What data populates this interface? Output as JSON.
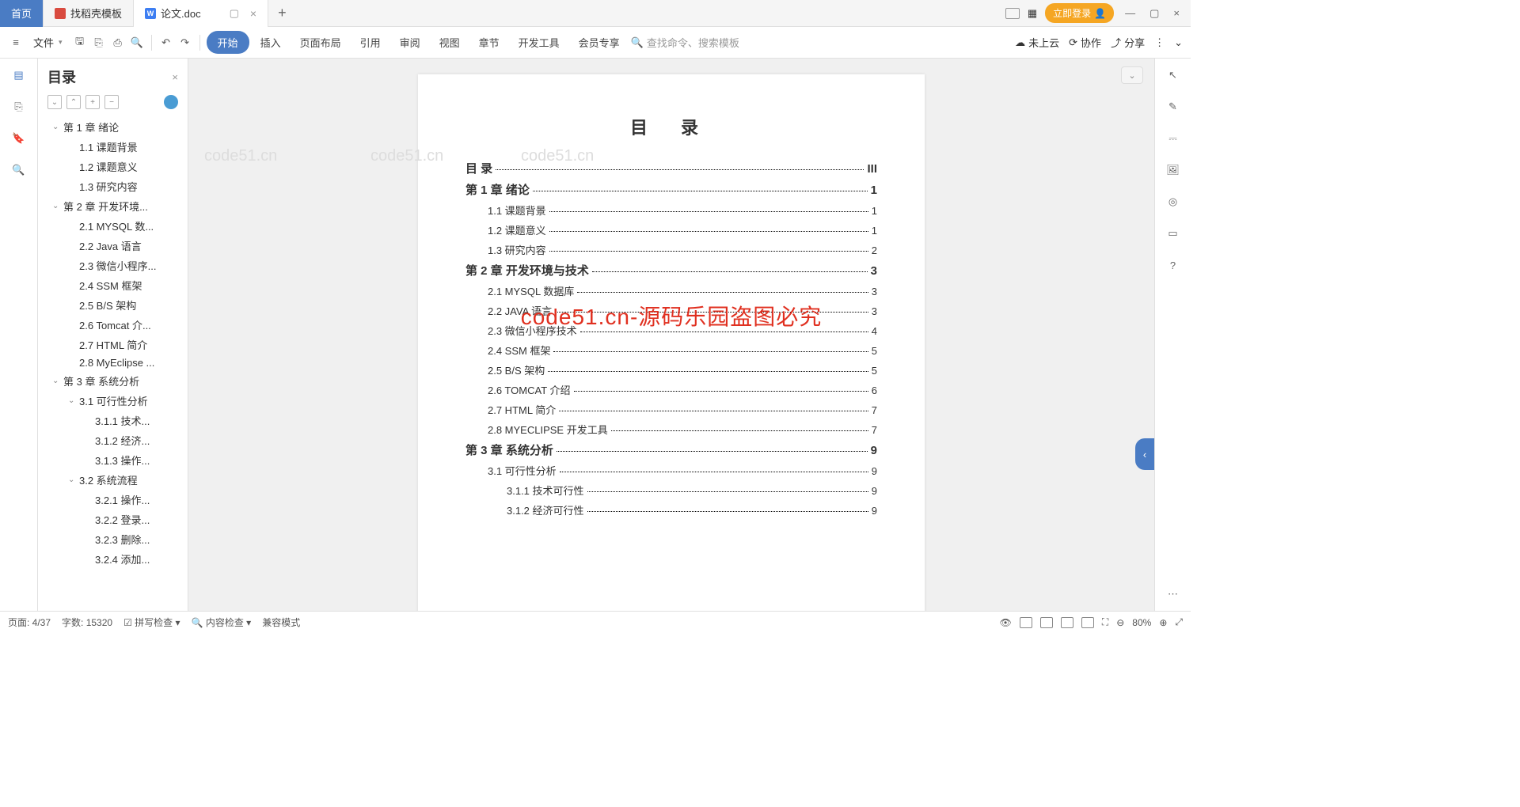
{
  "tabs": {
    "home": "首页",
    "template": "找稻壳模板",
    "document": "论文.doc"
  },
  "login_button": "立即登录",
  "file_label": "文件",
  "menu": {
    "start": "开始",
    "insert": "插入",
    "layout": "页面布局",
    "reference": "引用",
    "review": "审阅",
    "view": "视图",
    "chapter": "章节",
    "devtools": "开发工具",
    "member": "会员专享"
  },
  "search_placeholder": "查找命令、搜索模板",
  "cloud_status": "未上云",
  "collab": "协作",
  "share": "分享",
  "outline": {
    "title": "目录",
    "items": [
      {
        "level": 1,
        "text": "第 1 章 绪论",
        "chev": true
      },
      {
        "level": 2,
        "text": "1.1 课题背景"
      },
      {
        "level": 2,
        "text": "1.2 课题意义"
      },
      {
        "level": 2,
        "text": "1.3 研究内容"
      },
      {
        "level": 1,
        "text": "第 2 章 开发环境...",
        "chev": true
      },
      {
        "level": 2,
        "text": "2.1 MYSQL 数..."
      },
      {
        "level": 2,
        "text": "2.2 Java 语言"
      },
      {
        "level": 2,
        "text": "2.3 微信小程序..."
      },
      {
        "level": 2,
        "text": "2.4 SSM 框架"
      },
      {
        "level": 2,
        "text": "2.5 B/S 架构"
      },
      {
        "level": 2,
        "text": "2.6 Tomcat 介..."
      },
      {
        "level": 2,
        "text": "2.7 HTML 简介"
      },
      {
        "level": 2,
        "text": "2.8 MyEclipse ..."
      },
      {
        "level": 1,
        "text": "第 3 章 系统分析",
        "chev": true
      },
      {
        "level": 2,
        "text": "3.1 可行性分析",
        "chev": true
      },
      {
        "level": 3,
        "text": "3.1.1 技术..."
      },
      {
        "level": 3,
        "text": "3.1.2 经济..."
      },
      {
        "level": 3,
        "text": "3.1.3 操作..."
      },
      {
        "level": 2,
        "text": "3.2 系统流程",
        "chev": true
      },
      {
        "level": 3,
        "text": "3.2.1 操作..."
      },
      {
        "level": 3,
        "text": "3.2.2 登录..."
      },
      {
        "level": 3,
        "text": "3.2.3 删除..."
      },
      {
        "level": 3,
        "text": "3.2.4 添加..."
      }
    ]
  },
  "toc": {
    "heading": "目 录",
    "lines": [
      {
        "bold": true,
        "label": "目  录",
        "page": "III"
      },
      {
        "bold": true,
        "label": "第 1 章  绪论",
        "page": "1"
      },
      {
        "sub": true,
        "label": "1.1 课题背景",
        "page": "1"
      },
      {
        "sub": true,
        "label": "1.2 课题意义",
        "page": "1"
      },
      {
        "sub": true,
        "label": "1.3 研究内容",
        "page": "2"
      },
      {
        "bold": true,
        "label": "第 2 章  开发环境与技术",
        "page": "3"
      },
      {
        "sub": true,
        "label": "2.1 MYSQL 数据库",
        "page": "3"
      },
      {
        "sub": true,
        "label": "2.2 JAVA 语言",
        "page": "3"
      },
      {
        "sub": true,
        "label": "2.3 微信小程序技术",
        "page": "4"
      },
      {
        "sub": true,
        "label": "2.4 SSM 框架",
        "page": "5"
      },
      {
        "sub": true,
        "label": "2.5 B/S 架构",
        "page": "5"
      },
      {
        "sub": true,
        "label": "2.6 TOMCAT 介绍",
        "page": "6"
      },
      {
        "sub": true,
        "label": "2.7 HTML 简介",
        "page": "7"
      },
      {
        "sub": true,
        "label": "2.8 MYECLIPSE 开发工具",
        "page": "7"
      },
      {
        "bold": true,
        "label": "第 3 章  系统分析",
        "page": "9"
      },
      {
        "sub": true,
        "label": "3.1 可行性分析",
        "page": "9"
      },
      {
        "sub2": true,
        "label": "3.1.1 技术可行性",
        "page": "9"
      },
      {
        "sub2": true,
        "label": "3.1.2 经济可行性",
        "page": "9"
      }
    ]
  },
  "watermark_text": "code51.cn",
  "overlay_text": "code51.cn-源码乐园盗图必究",
  "status": {
    "page": "页面: 4/37",
    "words": "字数: 15320",
    "spell": "拼写检查",
    "content": "内容检查",
    "compat": "兼容模式",
    "zoom": "80%"
  }
}
